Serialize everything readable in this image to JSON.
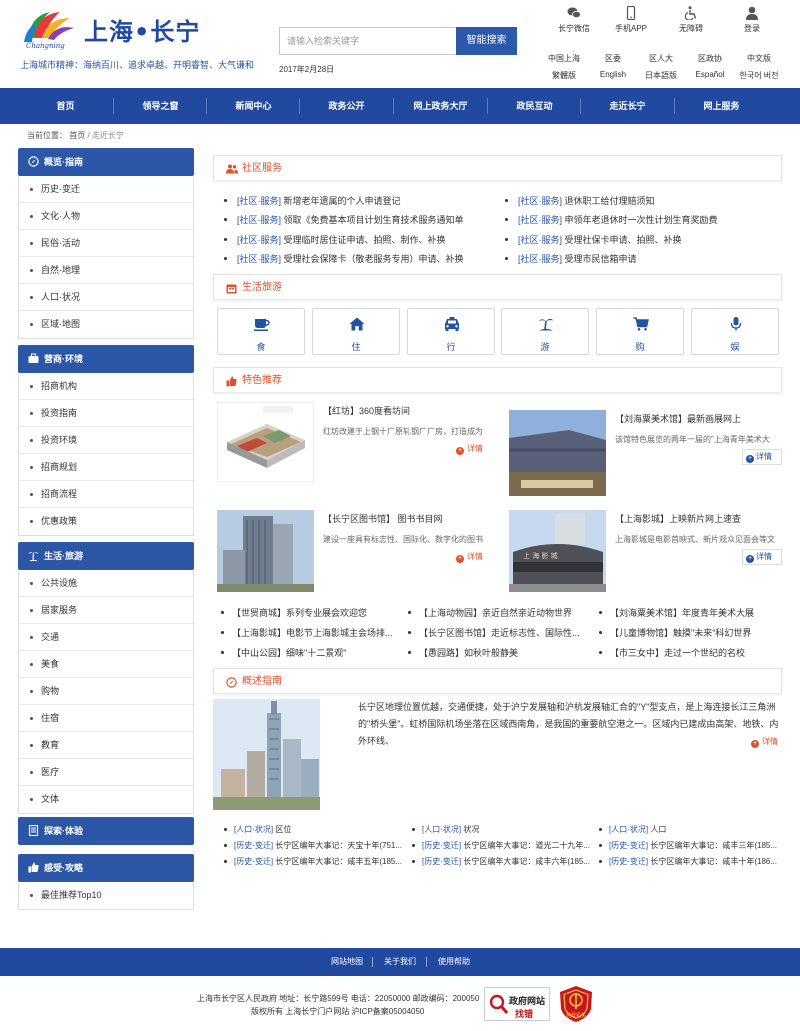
{
  "header": {
    "logo_text": "上海•长宁",
    "slogan": "上海城市精神：海纳百川、追求卓越、开明睿智、大气谦和",
    "search_placeholder": "请输入检索关键字",
    "search_button": "智能搜索",
    "date": "2017年2月28日",
    "quick_links": [
      {
        "label": "长宁微信",
        "icon": "wechat-icon"
      },
      {
        "label": "手机APP",
        "icon": "mobile-icon"
      },
      {
        "label": "无障碍",
        "icon": "accessibility-icon"
      },
      {
        "label": "登录",
        "icon": "user-icon"
      }
    ],
    "lang_row1": [
      "中国上海",
      "区委",
      "区人大",
      "区政协",
      "中文版"
    ],
    "lang_row2": [
      "繁體版",
      "English",
      "日本語版",
      "Español",
      "한국어 버전"
    ]
  },
  "nav": [
    "首页",
    "领导之窗",
    "新闻中心",
    "政务公开",
    "网上政务大厅",
    "政民互动",
    "走近长宁",
    "网上服务"
  ],
  "breadcrumb": {
    "prefix": "当前位置：",
    "home": "首页",
    "sep": "/",
    "current": "走近长宁"
  },
  "sidebar": [
    {
      "title": "概览·指南",
      "icon": "compass-icon",
      "items": [
        "历史·变迁",
        "文化·人物",
        "民俗·活动",
        "自然·地理",
        "人口·状况",
        "区域·地图"
      ]
    },
    {
      "title": "营商·环境",
      "icon": "briefcase-icon",
      "items": [
        "招商机构",
        "投资指南",
        "投资环境",
        "招商规划",
        "招商流程",
        "优惠政策"
      ]
    },
    {
      "title": "生活·旅游",
      "icon": "palm-icon",
      "items": [
        "公共设施",
        "居家服务",
        "交通",
        "美食",
        "购物",
        "住宿",
        "教育",
        "医疗",
        "文体"
      ]
    },
    {
      "title": "探索·体验",
      "icon": "book-icon",
      "items": []
    },
    {
      "title": "感受·攻略",
      "icon": "thumbs-up-icon",
      "items": [
        "最佳推荐Top10"
      ]
    }
  ],
  "community": {
    "title": "社区服务",
    "left": [
      {
        "tag": "[社区·服务]",
        "text": "新增老年遗属的个人申请登记"
      },
      {
        "tag": "[社区·服务]",
        "text": "领取《免费基本项目计划生育技术服务通知单"
      },
      {
        "tag": "[社区·服务]",
        "text": "受理临时居住证申请、拍照、制作、补换"
      },
      {
        "tag": "[社区·服务]",
        "text": "受理社会保障卡（敬老服务专用）申请、补换"
      }
    ],
    "right": [
      {
        "tag": "[社区·服务]",
        "text": "退休职工给付理赔须知"
      },
      {
        "tag": "[社区·服务]",
        "text": "申领年老退休时一次性计划生育奖励费"
      },
      {
        "tag": "[社区·服务]",
        "text": "受理社保卡申请、拍照、补换"
      },
      {
        "tag": "[社区·服务]",
        "text": "受理市民信箱申请"
      }
    ]
  },
  "travel": {
    "title": "生活旅游",
    "tiles": [
      {
        "label": "食",
        "icon": "cup-icon"
      },
      {
        "label": "住",
        "icon": "home-icon"
      },
      {
        "label": "行",
        "icon": "taxi-icon"
      },
      {
        "label": "游",
        "icon": "palm-icon"
      },
      {
        "label": "购",
        "icon": "cart-icon"
      },
      {
        "label": "娱",
        "icon": "microphone-icon"
      }
    ]
  },
  "featured": {
    "title": "特色推荐",
    "cards": [
      {
        "title": "【红坊】360度看坊间",
        "desc": "红坊改建于上钢十厂原轧钢厂厂房，打造成为",
        "detail": "详情"
      },
      {
        "title": "【刘海粟美术馆】最新画展网上",
        "desc": "该馆特色展览的两年一届的\"上海青年美术大",
        "detail": "详情"
      },
      {
        "title": "【长宁区图书馆】 图书书目网",
        "desc": "建设一座具有标志性、国际化、数字化的图书",
        "detail": "详情"
      },
      {
        "title": "【上海影城】上映新片网上速查",
        "desc": "上海影城是电影首映式、新片观众见面会等文",
        "detail": "详情"
      }
    ],
    "list": [
      "【世贸商城】系列专业展会欢迎您",
      "【上海动物园】亲近自然亲近动物世界",
      "【刘海粟美术馆】年度青年美术大展",
      "【上海影城】电影节上海影城主会场排...",
      "【长宁区图书馆】走近标志性、国际性...",
      "【儿童博物馆】触摸\"未来\"科幻世界",
      "【中山公园】细味\"十二景观\"",
      "【愚园路】如秋叶般静美",
      "【市三女中】走过一个世纪的名校"
    ]
  },
  "overview": {
    "title": "概述指南",
    "text": "长宁区地理位置优越，交通便捷，处于沪宁发展轴和沪杭发展轴汇合的\"Y\"型支点，是上海连接长江三角洲的\"桥头堡\"。虹桥国际机场坐落在区域西南角，是我国的重要航空港之一。区域内已建成由高架、地铁、内外环线、",
    "detail": "详情",
    "row1": [
      {
        "tag": "[人口·状况]",
        "text": "区位"
      },
      {
        "tag": "[人口·状况]",
        "text": "状况"
      },
      {
        "tag": "[人口·状况]",
        "text": "人口"
      }
    ],
    "row2": [
      {
        "tag": "[历史·变迁]",
        "text": "长宁区编年大事记：天宝十年(751..."
      },
      {
        "tag": "[历史·变迁]",
        "text": "长宁区编年大事记：道光二十九年..."
      },
      {
        "tag": "[历史·变迁]",
        "text": "长宁区编年大事记：咸丰三年(185..."
      }
    ],
    "row3": [
      {
        "tag": "[历史·变迁]",
        "text": "长宁区编年大事记：咸丰五年(185..."
      },
      {
        "tag": "[历史·变迁]",
        "text": "长宁区编年大事记：咸丰六年(185..."
      },
      {
        "tag": "[历史·变迁]",
        "text": "长宁区编年大事记：咸丰十年(186..."
      }
    ]
  },
  "footer": {
    "links": [
      "网站地图",
      "关于我们",
      "使用帮助"
    ],
    "line1": "上海市长宁区人民政府 地址：长宁路599号 电话：22050000 邮政编码：200050",
    "line2": "版权所有 上海长宁门户网站 沪ICP备案05004050",
    "badge1_top": "政府网站",
    "badge1_bottom": "找错",
    "badge2": "党政机关"
  },
  "colors": {
    "primary": "#21499f",
    "accent": "#e0512b",
    "link": "#2253a3"
  }
}
